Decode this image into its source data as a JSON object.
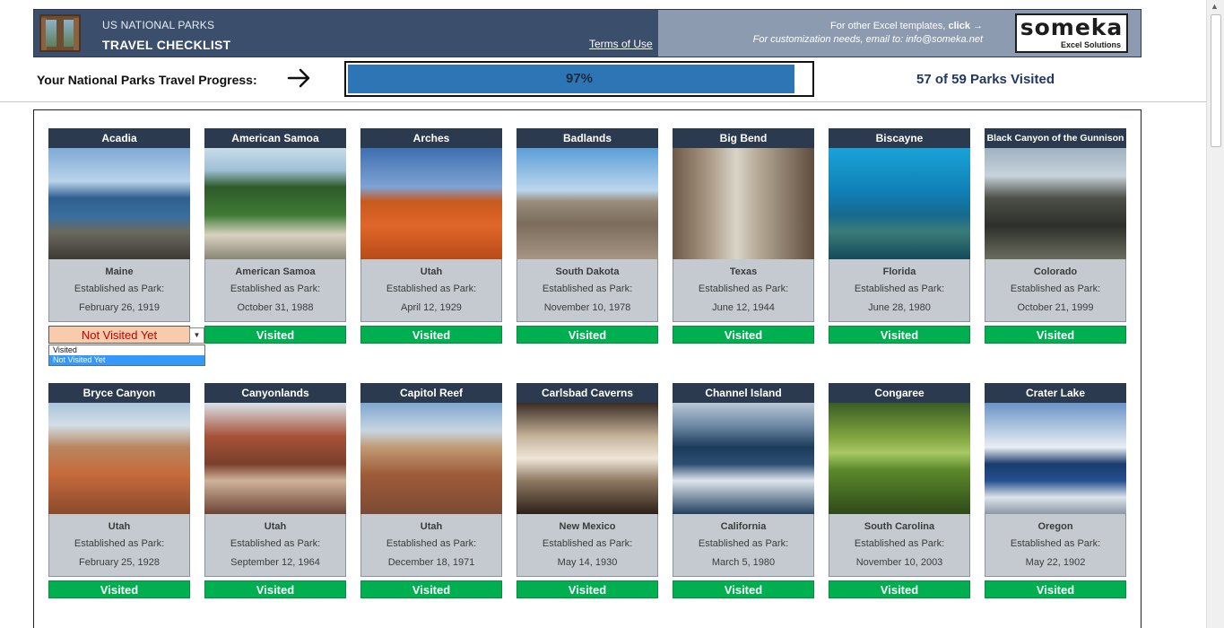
{
  "header": {
    "subtitle": "US NATIONAL PARKS",
    "title": "TRAVEL CHECKLIST",
    "terms_link": "Terms of Use",
    "templates_text": "For other Excel templates,",
    "templates_click": "click →",
    "customization_text": "For customization needs, email to: info@someka.net",
    "brand_name": "someka",
    "brand_tagline": "Excel Solutions"
  },
  "progress": {
    "label": "Your National Parks Travel Progress:",
    "arrow_icon": "arrow-right-icon",
    "percent_text": "97%",
    "percent_value": 0.966,
    "visited_text": "57 of 59 Parks Visited"
  },
  "established_label": "Established as Park:",
  "dropdown": {
    "options": [
      "Visited",
      "Not Visited Yet"
    ],
    "selected": "Not Visited Yet",
    "arrow_icon": "dropdown-arrow-icon"
  },
  "parks": [
    {
      "name": "Acadia",
      "state": "Maine",
      "date": "February 26, 1919",
      "status": "Not Visited Yet",
      "scene": "coast"
    },
    {
      "name": "American Samoa",
      "state": "American Samoa",
      "date": "October 31, 1988",
      "status": "Visited",
      "scene": "tropic"
    },
    {
      "name": "Arches",
      "state": "Utah",
      "date": "April 12, 1929",
      "status": "Visited",
      "scene": "arch"
    },
    {
      "name": "Badlands",
      "state": "South Dakota",
      "date": "November 10, 1978",
      "status": "Visited",
      "scene": "badlands"
    },
    {
      "name": "Big Bend",
      "state": "Texas",
      "date": "June 12, 1944",
      "status": "Visited",
      "scene": "canyon"
    },
    {
      "name": "Biscayne",
      "state": "Florida",
      "date": "June 28, 1980",
      "status": "Visited",
      "scene": "reef"
    },
    {
      "name": "Black Canyon of the Gunnison",
      "state": "Colorado",
      "date": "October 21, 1999",
      "status": "Visited",
      "scene": "gorge"
    },
    {
      "name": "Bryce Canyon",
      "state": "Utah",
      "date": "February 25, 1928",
      "status": "Visited",
      "scene": "bryce"
    },
    {
      "name": "Canyonlands",
      "state": "Utah",
      "date": "September 12, 1964",
      "status": "Visited",
      "scene": "canyonlands"
    },
    {
      "name": "Capitol Reef",
      "state": "Utah",
      "date": "December 18, 1971",
      "status": "Visited",
      "scene": "reefrock"
    },
    {
      "name": "Carlsbad Caverns",
      "state": "New Mexico",
      "date": "May 14, 1930",
      "status": "Visited",
      "scene": "cave"
    },
    {
      "name": "Channel Island",
      "state": "California",
      "date": "March 5, 1980",
      "status": "Visited",
      "scene": "island"
    },
    {
      "name": "Congaree",
      "state": "South Carolina",
      "date": "November 10, 2003",
      "status": "Visited",
      "scene": "swamp"
    },
    {
      "name": "Crater Lake",
      "state": "Oregon",
      "date": "May 22, 1902",
      "status": "Visited",
      "scene": "crater"
    }
  ],
  "colors": {
    "banner_dark": "#3b4e6b",
    "banner_light": "#8d9bb1",
    "progress_fill": "#2e75b6",
    "visited_green": "#00b050",
    "not_visited_fill": "#f8cbad",
    "not_visited_text": "#c00000",
    "card_header": "#2b3a4e",
    "card_info": "#c5cad1"
  }
}
